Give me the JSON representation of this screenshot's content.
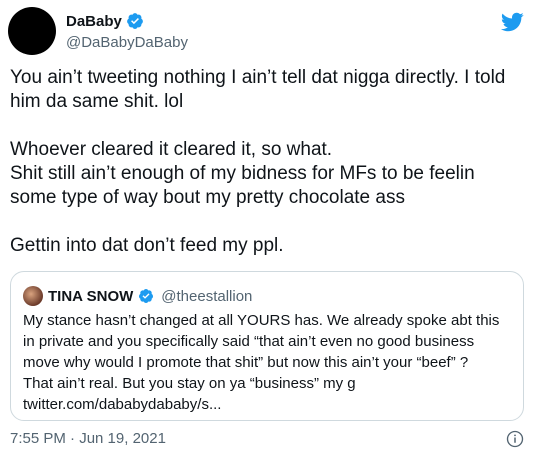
{
  "author": {
    "name": "DaBaby",
    "handle": "@DaBabyDaBaby"
  },
  "tweet": {
    "text": "You ain’t tweeting nothing I ain’t tell dat nigga directly. I told him da same shit. lol\n\nWhoever cleared it cleared it, so what.\nShit still ain’t enough of my bidness for MFs to be feelin some type of way bout my pretty chocolate ass\n\nGettin into dat don’t feed my ppl.",
    "timestamp": "7:55 PM · Jun 19, 2021"
  },
  "quoted": {
    "name": "TINA SNOW",
    "handle": "@theestallion",
    "text": "My stance hasn’t changed at all YOURS has. We already spoke abt this\nin private and you specifically said “that ain’t even no good business\nmove why would I promote that shit” but now this ain’t your “beef” ?\nThat ain’t real. But you stay on ya “business” my g\ntwitter.com/dababydababy/s..."
  },
  "icons": {
    "verified": "verified-badge-icon",
    "logo": "twitter-bird-icon",
    "info": "info-icon"
  },
  "colors": {
    "brand": "#1d9bf0",
    "text": "#0f1419",
    "secondary": "#536471",
    "border": "#cfd9de"
  }
}
